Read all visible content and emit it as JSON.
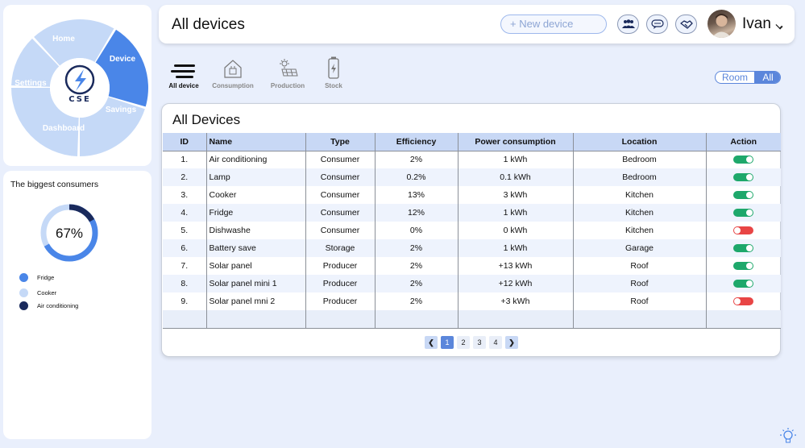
{
  "nav": {
    "logo_text": "CSE",
    "segments": [
      "Home",
      "Device",
      "Savings",
      "Dashboard",
      "Settings"
    ],
    "active": "Device"
  },
  "header": {
    "title": "All devices",
    "new_device_placeholder": "+ New device",
    "icons": [
      "group-icon",
      "chat-bubble-icon",
      "handshake-icon"
    ],
    "user_name": "Ivan"
  },
  "tabs": [
    {
      "label": "All device",
      "icon": "list-icon",
      "active": true
    },
    {
      "label": "Consumption",
      "icon": "house-plug-icon",
      "active": false
    },
    {
      "label": "Production",
      "icon": "solar-panel-icon",
      "active": false
    },
    {
      "label": "Stock",
      "icon": "battery-icon",
      "active": false
    }
  ],
  "view_toggle": {
    "options": [
      "Room",
      "All"
    ],
    "selected": "All"
  },
  "devices": {
    "title": "All Devices",
    "columns": [
      "ID",
      "Name",
      "Type",
      "Efficiency",
      "Power consumption",
      "Location",
      "Action"
    ],
    "rows": [
      {
        "id": "1.",
        "name": "Air conditioning",
        "type": "Consumer",
        "efficiency": "2%",
        "power": "1 kWh",
        "location": "Bedroom",
        "on": true
      },
      {
        "id": "2.",
        "name": "Lamp",
        "type": "Consumer",
        "efficiency": "0.2%",
        "power": "0.1 kWh",
        "location": "Bedroom",
        "on": true
      },
      {
        "id": "3.",
        "name": "Cooker",
        "type": "Consumer",
        "efficiency": "13%",
        "power": "3 kWh",
        "location": "Kitchen",
        "on": true
      },
      {
        "id": "4.",
        "name": "Fridge",
        "type": "Consumer",
        "efficiency": "12%",
        "power": "1 kWh",
        "location": "Kitchen",
        "on": true
      },
      {
        "id": "5.",
        "name": "Dishwashe",
        "type": "Consumer",
        "efficiency": "0%",
        "power": "0 kWh",
        "location": "Kitchen",
        "on": false
      },
      {
        "id": "6.",
        "name": "Battery save",
        "type": "Storage",
        "efficiency": "2%",
        "power": "1 kWh",
        "location": "Garage",
        "on": true
      },
      {
        "id": "7.",
        "name": "Solar panel",
        "type": "Producer",
        "efficiency": "2%",
        "power": "+13 kWh",
        "location": "Roof",
        "on": true
      },
      {
        "id": "8.",
        "name": "Solar panel mini 1",
        "type": "Producer",
        "efficiency": "2%",
        "power": "+12 kWh",
        "location": "Roof",
        "on": true
      },
      {
        "id": "9.",
        "name": "Solar panel mni 2",
        "type": "Producer",
        "efficiency": "2%",
        "power": "+3 kWh",
        "location": "Roof",
        "on": false
      }
    ]
  },
  "pagination": {
    "prev": "❮",
    "pages": [
      "1",
      "2",
      "3",
      "4"
    ],
    "current": "1",
    "next": "❯"
  },
  "consumers": {
    "title": "The biggest consumers",
    "percent_label": "67%",
    "progress": 0.67,
    "legend": [
      {
        "label": "Fridge",
        "color": "#4a86e8"
      },
      {
        "label": "Cooker",
        "color": "#c5d9f7"
      },
      {
        "label": "Air conditioning",
        "color": "#1a2a5c"
      }
    ]
  },
  "colors": {
    "accent": "#5b86db",
    "on": "#1ea86b",
    "off": "#e84545"
  }
}
